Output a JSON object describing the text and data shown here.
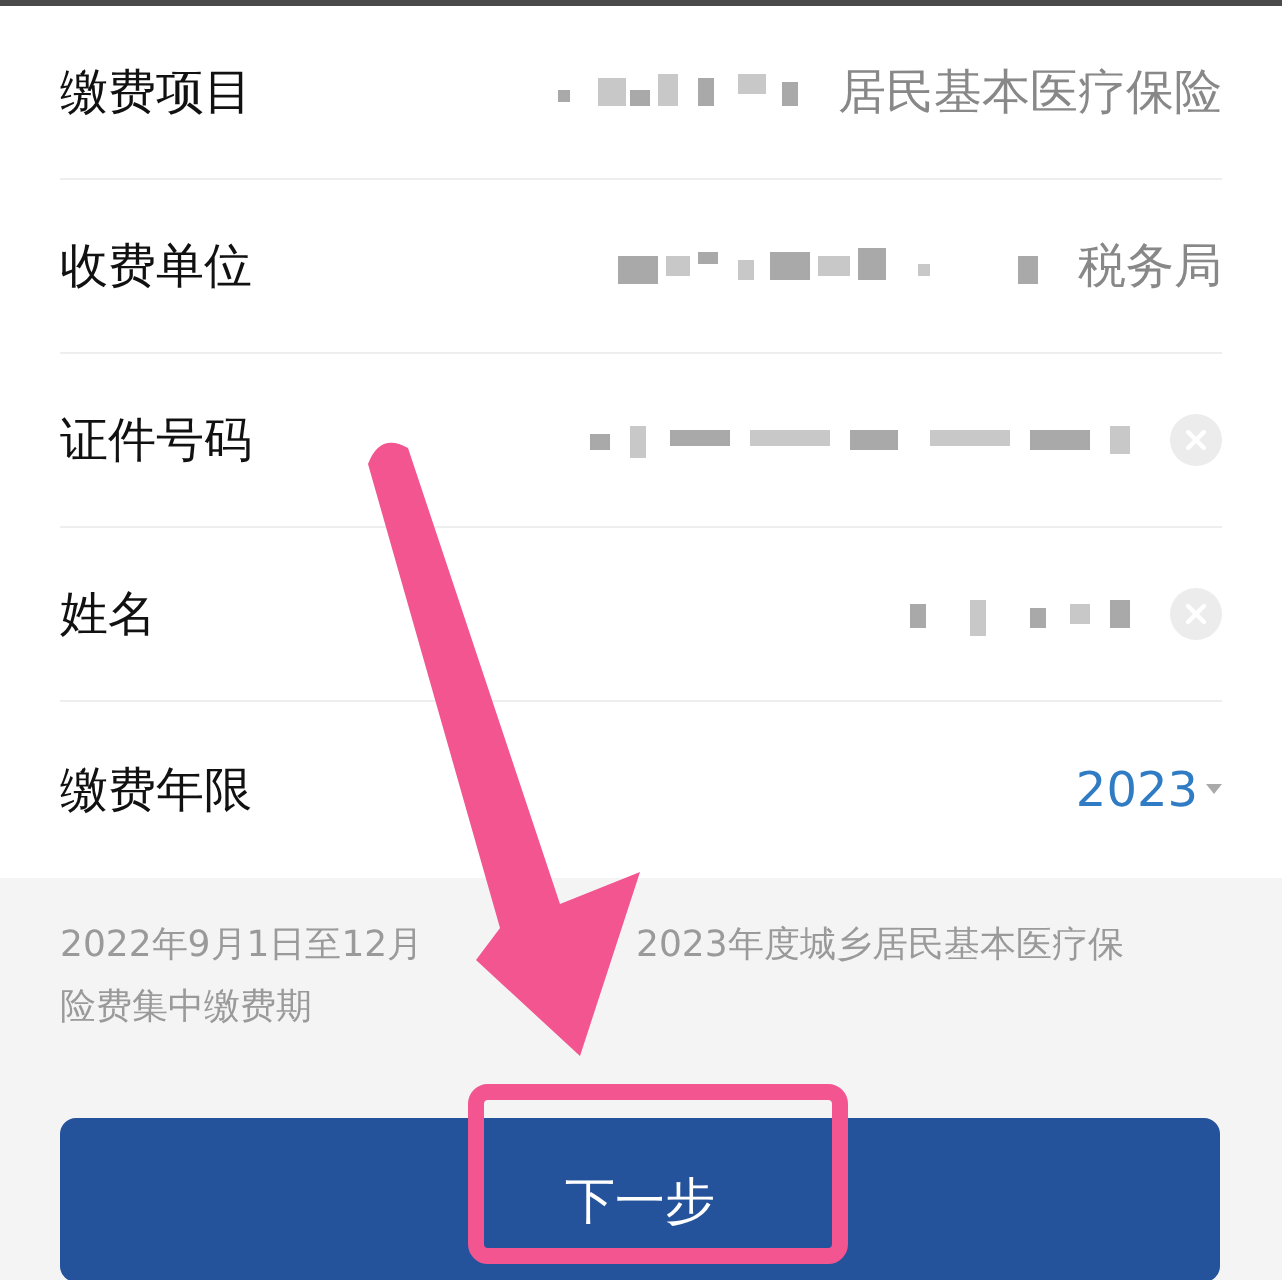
{
  "rows": [
    {
      "label": "缴费项目",
      "kind": "text",
      "value": "居民基本医疗保险"
    },
    {
      "label": "收费单位",
      "kind": "text",
      "value": "税务局"
    },
    {
      "label": "证件号码",
      "kind": "clearable"
    },
    {
      "label": "姓名",
      "kind": "clearable"
    },
    {
      "label": "缴费年限",
      "kind": "select",
      "value": "2023"
    }
  ],
  "notice": [
    "2022年9月1日至12月",
    "2023年度城乡居民基本医疗保",
    "险费集中缴费期"
  ],
  "button": "下一步"
}
